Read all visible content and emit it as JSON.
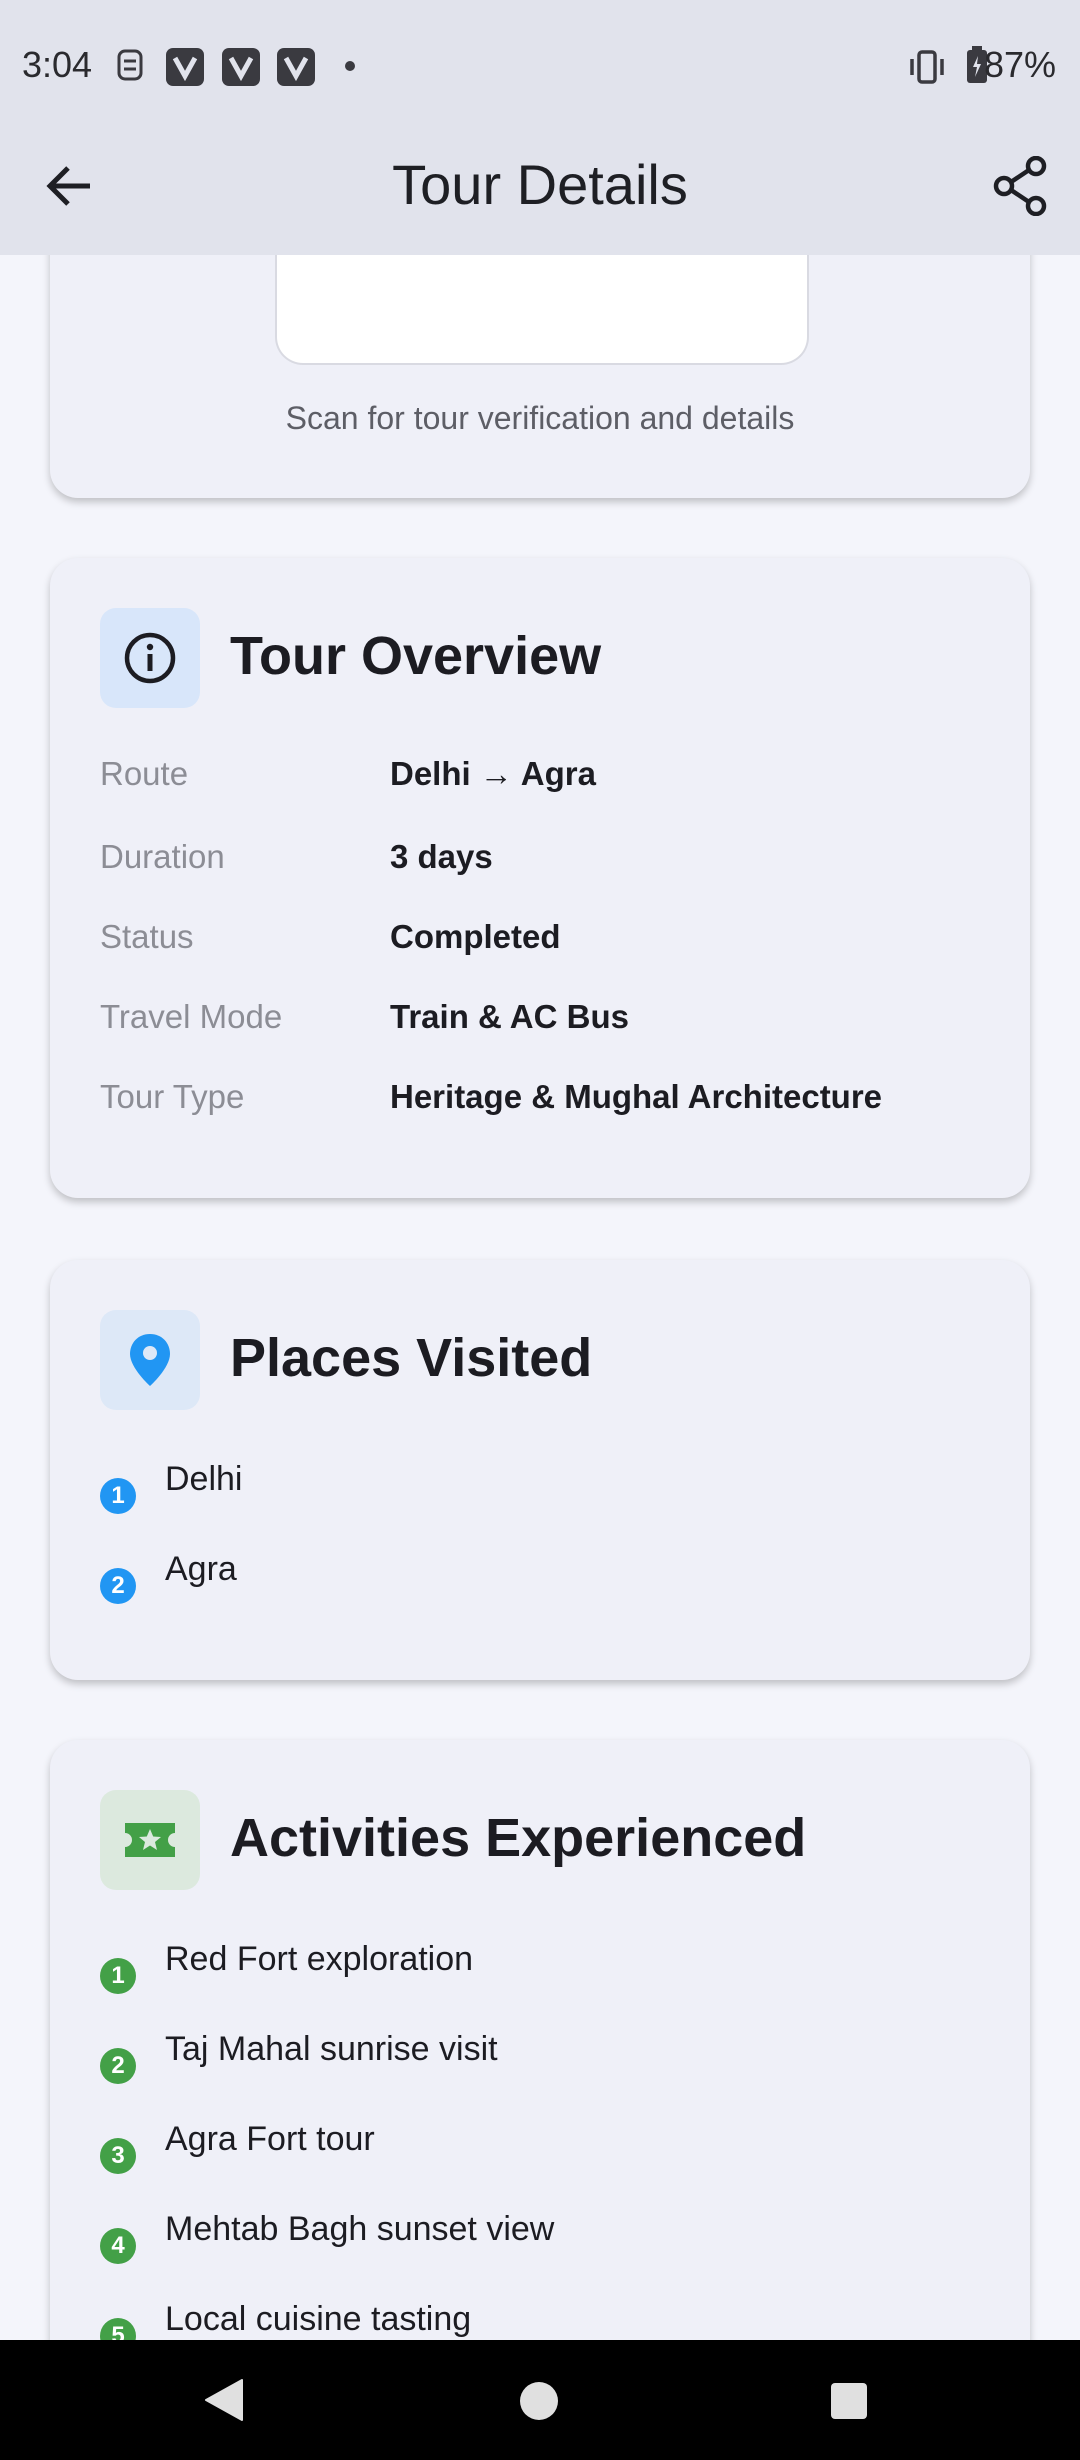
{
  "status_bar": {
    "time": "3:04",
    "battery": "87%",
    "icons": [
      "sim-icon",
      "vpn-icon",
      "vpn-icon",
      "vpn-icon",
      "dot-icon",
      "vibrate-icon",
      "battery-icon"
    ]
  },
  "app_bar": {
    "title": "Tour Details",
    "back_icon": "arrow-back-icon",
    "share_icon": "share-icon"
  },
  "qr_card": {
    "caption": "Scan for tour verification and details"
  },
  "overview": {
    "title": "Tour Overview",
    "icon": "info-icon",
    "rows": [
      {
        "label": "Route",
        "value": "Delhi → Agra"
      },
      {
        "label": "Duration",
        "value": "3 days"
      },
      {
        "label": "Status",
        "value": "Completed"
      },
      {
        "label": "Travel Mode",
        "value": "Train & AC Bus"
      },
      {
        "label": "Tour Type",
        "value": "Heritage & Mughal Architecture"
      }
    ]
  },
  "places": {
    "title": "Places Visited",
    "icon": "location-pin-icon",
    "accent": "#2196f3",
    "items": [
      {
        "num": "1",
        "label": "Delhi"
      },
      {
        "num": "2",
        "label": "Agra"
      }
    ]
  },
  "activities": {
    "title": "Activities Experienced",
    "icon": "ticket-icon",
    "accent": "#43a047",
    "items": [
      {
        "num": "1",
        "label": "Red Fort exploration"
      },
      {
        "num": "2",
        "label": "Taj Mahal sunrise visit"
      },
      {
        "num": "3",
        "label": "Agra Fort tour"
      },
      {
        "num": "4",
        "label": "Mehtab Bagh sunset view"
      },
      {
        "num": "5",
        "label": "Local cuisine tasting"
      }
    ]
  },
  "nav_bar": {
    "icons": [
      "back-triangle-icon",
      "home-circle-icon",
      "recents-square-icon"
    ]
  }
}
